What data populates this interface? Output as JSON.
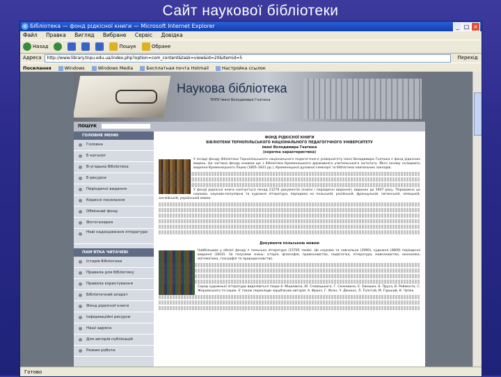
{
  "slide": {
    "title": "Сайт наукової бібліотеки"
  },
  "browser": {
    "title": "Бібліотека — фонд рідкісної книги — Microsoft Internet Explorer",
    "menu": [
      "Файл",
      "Правка",
      "Вигляд",
      "Вибране",
      "Сервіс",
      "Довідка"
    ],
    "toolbar": {
      "back": "Назад",
      "forward": "",
      "search": "Пошук",
      "favorites": "Обране"
    },
    "address_label": "Адреса",
    "address_value": "http://www.library.tnpu.edu.ua/index.php?option=com_content&task=view&id=20&Itemid=5",
    "go_label": "Перехід",
    "links_label": "Посилання",
    "links": [
      "Windows",
      "Windows Media",
      "Бесплатная почта Hotmail",
      "Настройка ссылок"
    ],
    "status": "Готово"
  },
  "site": {
    "title": "Наукова бібліотека",
    "subtitle": "ТНПУ імені Володимира Гнатюка",
    "search_label": "ПОШУК",
    "main_menu_title": "ГОЛОВНЕ МЕНЮ",
    "main_menu": [
      "Головна",
      "Е-каталог",
      "В-угадька бібліотека",
      "Е-ресурси",
      "Періодичні видання",
      "Корисні посилання",
      "Обмінний фонд",
      "Фотогалерея",
      "Нові надходження літератури"
    ],
    "reader_menu_title": "ПАМ'ЯТКА ЧИТАЧЕВІ",
    "reader_menu": [
      "Історія бібліотеки",
      "Правила для бібліотеку",
      "Правила користування",
      "Бібліотечний апарат",
      "Фонд рідкісної книги",
      "Інформаційні ресурси",
      "Наші адреса",
      "Для авторів публікацій",
      "Режим роботи"
    ]
  },
  "article": {
    "heading1": "ФОНД РІДКІСНОЇ КНИГИ",
    "heading2": "БІБЛІОТЕКИ ТЕРНОПІЛЬСЬКОГО НАЦІОНАЛЬНОГО ПЕДАГОГІЧНОГО УНІВЕРСИТЕТУ",
    "heading3": "імені Володимира Гнатюка",
    "heading4": "(коротка характеристика)",
    "para1": "У складі фонду бібліотеки Тернопільського національного педагогічного університету імені Володимира Гнатюка є фонд рідкісних видань. Це частина фонду книжки ще з бібліотеки Кременецького державного учительського інституту. Його основу складають видання Кременецького Ліцею (1805–1831 рр.), Кременецької духовної семінарії та бібліотеки навчальних закладів.",
    "para2": "У фонді рідкісної книги налічується понад 21276 документів (книги і періодичні видання), виданих до 1947 року. Переважно це наукова, науково-популярна та художня література, періодика на польській, російській, французькій, латинській, німецькій, англійській, українській мовах.",
    "heading5": "Документи польською мовою",
    "para3": "Найбільшим у обсязі фонду є польська література (15705 томів). Це наукова та навчальна (3090), художня (4809) періодичні видання (2810). За галузями знань: історія, філософія, правознавство, педагогіка, література, мовознавство, економіка, математика, географія та природознавство.",
    "para4": "Серед художньої літератури виділяються твори А. Міцкевича, Ю. Словацького, Г. Сенкевича, Е. Ожешко, Б. Пруса, В. Реймонта, С. Жеромського та інших. Є також переклади зарубіжних авторів: А. Франс, Г. Ібсен, Ч. Діккенс, Л. Толстой, М. Горький, К. Чапек."
  }
}
